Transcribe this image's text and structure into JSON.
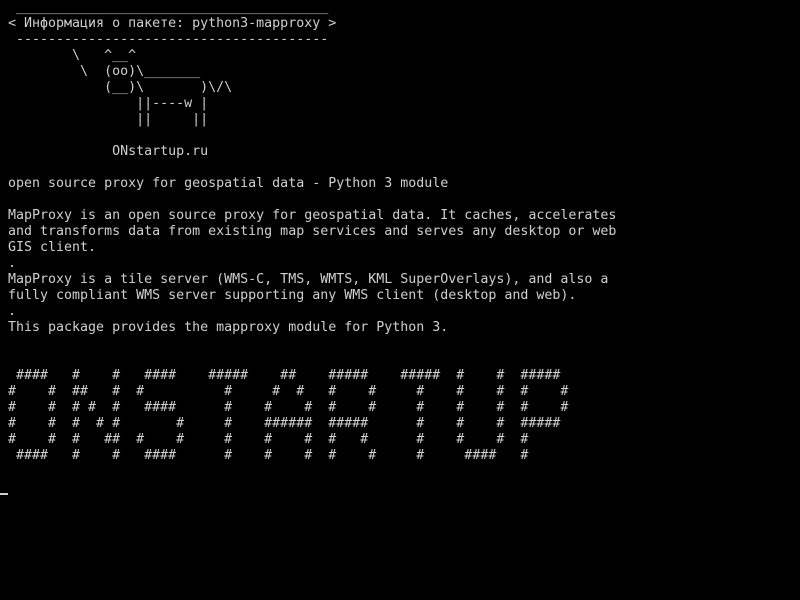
{
  "terminal": {
    "colors": {
      "background": "#000000",
      "foreground": "#d0d0d0"
    },
    "lines": [
      " _______________________________________",
      "< Информация о пакете: python3-mapproxy >",
      " ---------------------------------------",
      "        \\   ^__^",
      "         \\  (oo)\\_______",
      "            (__)\\       )\\/\\",
      "                ||----w |",
      "                ||     ||",
      "",
      "             ONstartup.ru",
      "",
      "open source proxy for geospatial data - Python 3 module",
      "",
      "MapProxy is an open source proxy for geospatial data. It caches, accelerates",
      "and transforms data from existing map services and serves any desktop or web",
      "GIS client.",
      ".",
      "MapProxy is a tile server (WMS-C, TMS, WMTS, KML SuperOverlays), and also a",
      "fully compliant WMS server supporting any WMS client (desktop and web).",
      ".",
      "This package provides the mapproxy module for Python 3.",
      "",
      "",
      " ####   #    #   ####    #####    ##    #####    #####  #    #  #####",
      "#    #  ##   #  #          #     #  #   #    #     #    #    #  #    #",
      "#    #  # #  #   ####      #    #    #  #    #     #    #    #  #    #",
      "#    #  #  # #       #     #    ######  #####      #    #    #  #####",
      "#    #  #   ##  #    #     #    #    #  #   #      #    #    #  #",
      " ####   #    #   ####      #    #    #  #    #     #     ####   #"
    ]
  }
}
